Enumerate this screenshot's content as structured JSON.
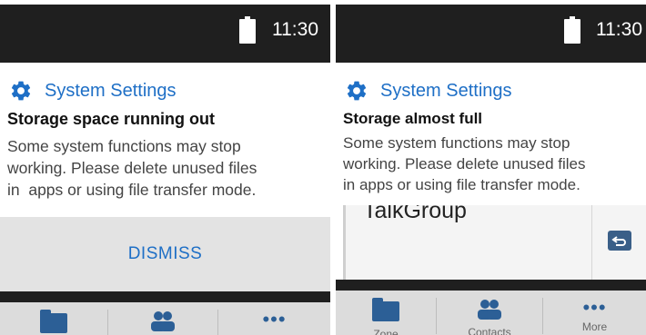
{
  "screens": [
    {
      "status_bar": {
        "time": "11:30"
      },
      "notification": {
        "app_name": "System Settings",
        "title": "Storage space running out",
        "body_lines": [
          "Some system functions may stop",
          "working. Please delete unused files",
          "in  apps or using file transfer mode."
        ]
      },
      "dismiss_label": "DISMISS"
    },
    {
      "status_bar": {
        "time": "11:30"
      },
      "notification": {
        "app_name": "System Settings",
        "title": "Storage almost full",
        "body_lines": [
          "Some system functions may stop",
          "working. Please delete unused files",
          "in apps or using file transfer mode."
        ]
      },
      "background_text": "TalkGroup",
      "nav": {
        "items": [
          "Zone",
          "Contacts",
          "More"
        ]
      }
    }
  ],
  "colors": {
    "accent": "#1e6fc6",
    "status_bar": "#1f1f1f",
    "icon_blue": "#2c5f96"
  },
  "icons": [
    "battery-icon",
    "gear-icon",
    "folder-icon",
    "contacts-icon",
    "more-icon",
    "back-icon"
  ]
}
